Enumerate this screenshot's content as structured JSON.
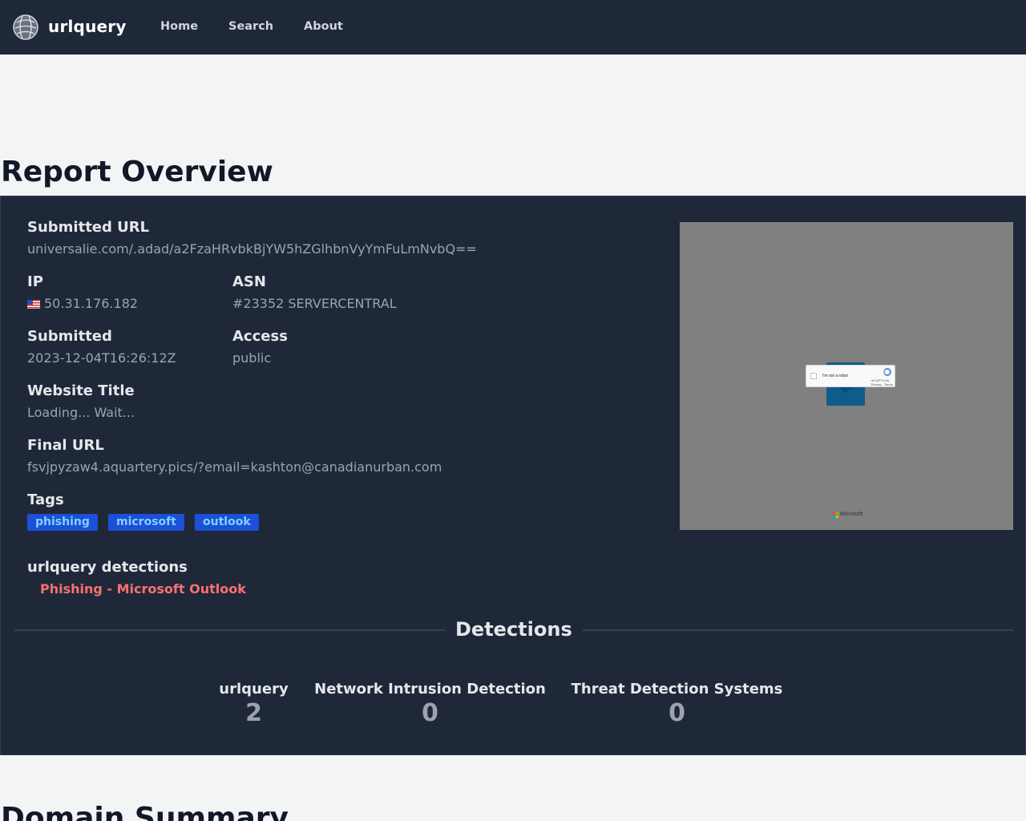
{
  "nav": {
    "brand": "urlquery",
    "links": [
      "Home",
      "Search",
      "About"
    ]
  },
  "page_title": "Report Overview",
  "overview": {
    "submitted_url_label": "Submitted URL",
    "submitted_url": "universalie.com/.adad/a2FzaHRvbkBjYW5hZGlhbnVyYmFuLmNvbQ==",
    "ip_label": "IP",
    "ip": "50.31.176.182",
    "asn_label": "ASN",
    "asn": "#23352 SERVERCENTRAL",
    "submitted_label": "Submitted",
    "submitted": "2023-12-04T16:26:12Z",
    "access_label": "Access",
    "access": "public",
    "website_title_label": "Website Title",
    "website_title": "Loading... Wait...",
    "final_url_label": "Final URL",
    "final_url": "fsvjpyzaw4.aquartery.pics/?email=kashton@canadianurban.com",
    "tags_label": "Tags",
    "tags": [
      "phishing",
      "microsoft",
      "outlook"
    ],
    "urlquery_detections_label": "urlquery detections",
    "urlquery_detection": "Phishing - Microsoft Outlook"
  },
  "preview": {
    "captcha_text": "I'm not a robot",
    "captcha_brand": "reCAPTCHA",
    "captcha_links": "Privacy - Terms",
    "footer_text": "Microsoft"
  },
  "detections": {
    "title": "Detections",
    "stats": [
      {
        "label": "urlquery",
        "count": "2"
      },
      {
        "label": "Network Intrusion Detection",
        "count": "0"
      },
      {
        "label": "Threat Detection Systems",
        "count": "0"
      }
    ]
  },
  "domain_summary_title": "Domain Summary",
  "colors": {
    "navbar_bg": "#1f2839",
    "card_bg": "#1f2839",
    "page_bg": "#f3f4f6",
    "tag_bg": "#1d4fd8",
    "tag_text": "#7dd3fc",
    "detection_red": "#f87171"
  }
}
